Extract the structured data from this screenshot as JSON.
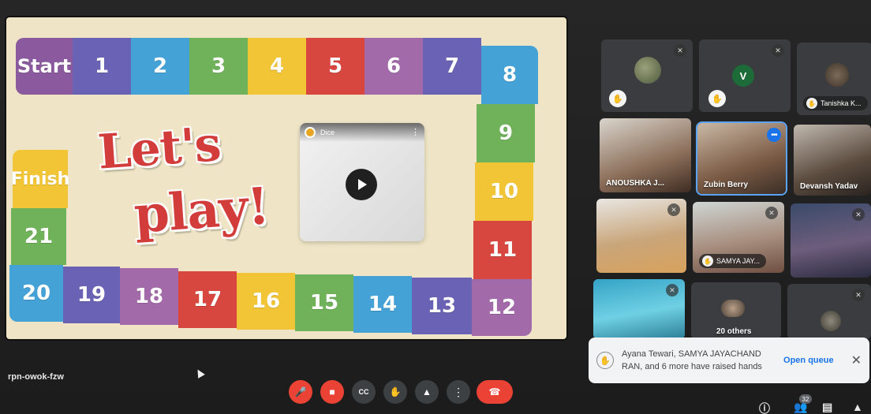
{
  "presentation": {
    "board": {
      "start_label": "Start",
      "finish_label": "Finish",
      "top_row": [
        "1",
        "2",
        "3",
        "4",
        "5",
        "6",
        "7",
        "8"
      ],
      "right_col": [
        "9",
        "10",
        "11",
        "12"
      ],
      "bottom_row": [
        "13",
        "14",
        "15",
        "16",
        "17",
        "18",
        "19",
        "20"
      ],
      "left_col": [
        "21"
      ],
      "title_line1": "Let's",
      "title_line2": "play!"
    },
    "video": {
      "title": "Dice"
    }
  },
  "participants": [
    {
      "name": "",
      "hand_raised": true,
      "muted": true
    },
    {
      "initial": "V",
      "name": "",
      "hand_raised": true,
      "muted": true
    },
    {
      "name": "Tanishka K...",
      "hand_raised": true
    },
    {
      "name": "ANOUSHKA J..."
    },
    {
      "name": "Zubin Berry",
      "active": true
    },
    {
      "name": "Devansh Yadav"
    },
    {
      "name": "",
      "muted": true
    },
    {
      "name": "SAMYA JAY...",
      "hand_raised": true,
      "muted": true
    },
    {
      "name": "",
      "muted": true
    },
    {
      "name": "",
      "muted": true
    },
    {
      "name": "20 others"
    },
    {
      "name": "",
      "muted": true
    }
  ],
  "notification": {
    "text": "Ayana Tewari, SAMYA JAYACHAND RAN, and 6 more have raised hands",
    "action": "Open queue",
    "close": "✕"
  },
  "meeting": {
    "code": "rpn-owok-fzw",
    "people_count": "32"
  },
  "colors": {
    "board_bg": "#efe5c6",
    "purple": "#8b5a9e",
    "indigo": "#6a63b5",
    "blue": "#45a2d6",
    "green": "#6fb25a",
    "yellow": "#f2c537",
    "red": "#d8473f",
    "control_red": "#ea4335",
    "control_gray": "#3c4043"
  }
}
